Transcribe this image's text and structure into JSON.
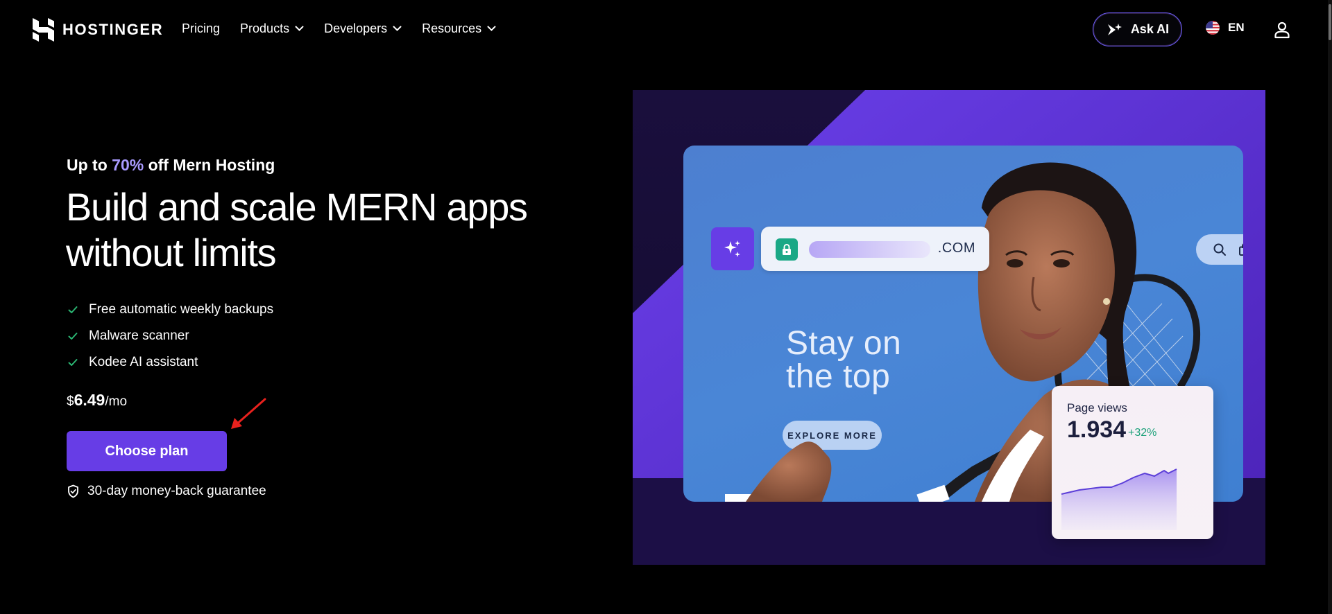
{
  "nav": {
    "brand": "HOSTINGER",
    "links": [
      {
        "label": "Pricing",
        "dropdown": false
      },
      {
        "label": "Products",
        "dropdown": true
      },
      {
        "label": "Developers",
        "dropdown": true
      },
      {
        "label": "Resources",
        "dropdown": true
      }
    ],
    "ask_ai_label": "Ask AI",
    "language": "EN"
  },
  "hero": {
    "promo_prefix": "Up to ",
    "promo_discount": "70%",
    "promo_suffix": " off Mern Hosting",
    "headline_line1": "Build and scale MERN apps",
    "headline_line2": "without limits",
    "features": [
      "Free automatic weekly backups",
      "Malware scanner",
      "Kodee AI assistant"
    ],
    "price_currency": "$",
    "price_amount": "6.49",
    "price_period": "/mo",
    "cta_label": "Choose plan",
    "guarantee": "30-day money-back guarantee"
  },
  "visual": {
    "url_tld": ".COM",
    "tagline_line1": "Stay on",
    "tagline_line2": "the top",
    "explore_label": "EXPLORE MORE",
    "stats": {
      "label": "Page views",
      "value": "1.934",
      "change": "+32%"
    }
  },
  "colors": {
    "brand_purple": "#673de6",
    "accent_text": "#a99bff",
    "check_green": "#2bb673",
    "annotation_red": "#e8211d"
  }
}
